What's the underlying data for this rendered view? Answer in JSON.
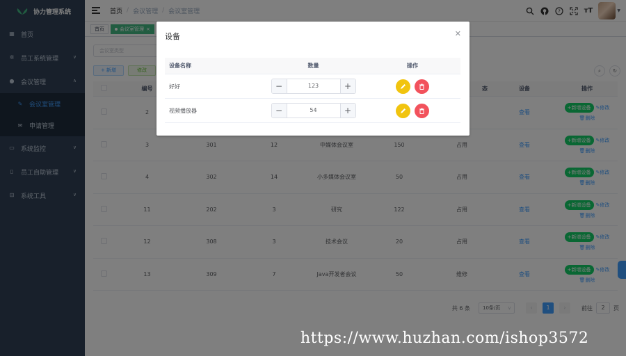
{
  "app": {
    "title": "协力管理系统"
  },
  "sidebar": {
    "items": [
      {
        "label": "首页",
        "icon": "dashboard-icon"
      },
      {
        "label": "员工系统管理",
        "icon": "gear-icon"
      },
      {
        "label": "会议管理",
        "icon": "chat-icon"
      },
      {
        "label": "系统监控",
        "icon": "monitor-icon"
      },
      {
        "label": "员工自助管理",
        "icon": "phone-icon"
      },
      {
        "label": "系统工具",
        "icon": "toolbox-icon"
      }
    ],
    "subitems": [
      {
        "label": "会议室管理",
        "icon": "edit-icon"
      },
      {
        "label": "申请管理",
        "icon": "mail-icon"
      }
    ]
  },
  "breadcrumb": {
    "home": "首页",
    "level1": "会议管理",
    "level2": "会议室管理"
  },
  "tags": {
    "home": "首页",
    "active": "会议室管理"
  },
  "main": {
    "search_placeholder": "会议室类型",
    "add_label": "+ 新增",
    "edit_label": "修改"
  },
  "table": {
    "headers": [
      "编号",
      "",
      "",
      "",
      "",
      "",
      "设备",
      "操作"
    ],
    "header_status": "态",
    "rows": [
      {
        "id": "2",
        "room": "",
        "floor": "",
        "name": "",
        "cap": "",
        "status": ""
      },
      {
        "id": "3",
        "room": "301",
        "floor": "12",
        "name": "中媒体会议室",
        "cap": "150",
        "status": "占用"
      },
      {
        "id": "4",
        "room": "302",
        "floor": "14",
        "name": "小多媒体会议室",
        "cap": "50",
        "status": "占用"
      },
      {
        "id": "11",
        "room": "202",
        "floor": "3",
        "name": "研究",
        "cap": "122",
        "status": "占用"
      },
      {
        "id": "12",
        "room": "308",
        "floor": "3",
        "name": "技术会议",
        "cap": "20",
        "status": "占用"
      },
      {
        "id": "13",
        "room": "309",
        "floor": "7",
        "name": "Java开发者会议",
        "cap": "50",
        "status": "维修"
      }
    ],
    "view_label": "查看",
    "add_device_label": "+新增设备",
    "edit_label": "修改",
    "delete_label": "删除"
  },
  "pager": {
    "total": "共 6 条",
    "page_size": "10条/页",
    "current": "1",
    "goto": "前往",
    "goto_value": "2",
    "page_unit": "页"
  },
  "dialog": {
    "title": "设备",
    "headers": [
      "设备名称",
      "数量",
      "操作"
    ],
    "rows": [
      {
        "name": "好好",
        "qty": "123"
      },
      {
        "name": "视频播放器",
        "qty": "54"
      }
    ]
  },
  "watermark": "https://www.huzhan.com/ishop3572",
  "colors": {
    "sidebar": "#304156",
    "primary": "#409eff",
    "success": "#13ce66",
    "warning": "#f1c40f",
    "danger": "#f2525c"
  }
}
